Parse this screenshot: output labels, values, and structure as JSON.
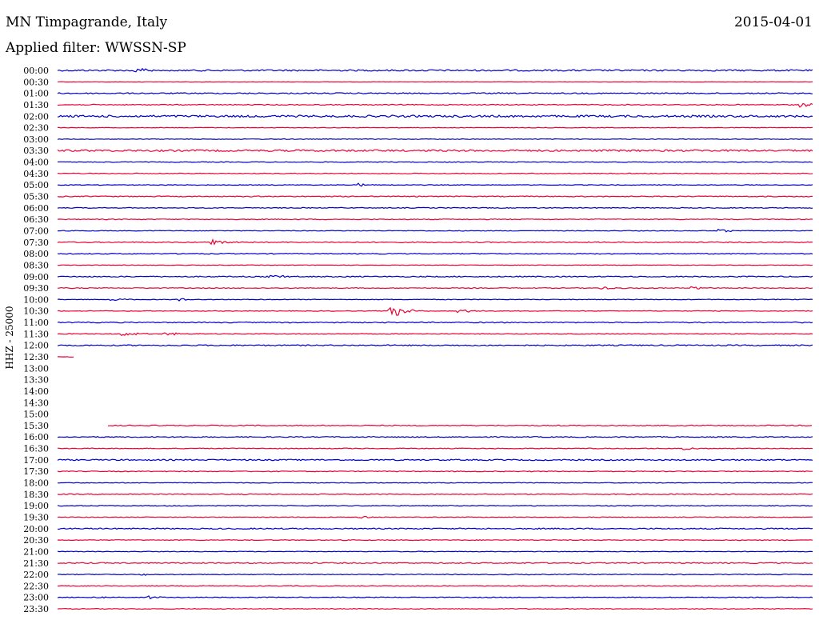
{
  "header": {
    "station": "MN Timpagrande, Italy",
    "date": "2015-04-01",
    "filter": "Applied filter: WWSSN-SP"
  },
  "channel_label": "HHZ - 25000",
  "colors": {
    "even_row": "#0000cc",
    "odd_row": "#ee0033"
  },
  "chart_data": {
    "type": "line",
    "title": "MN Timpagrande, Italy",
    "subtitle": "Applied filter: WWSSN-SP",
    "ylabel": "HHZ - 25000",
    "xlabel": "",
    "rows": [
      {
        "time": "00:00",
        "activity": 1.2,
        "events": [
          {
            "x": 0.1,
            "amp": 6
          }
        ]
      },
      {
        "time": "00:30",
        "activity": 0.3,
        "events": []
      },
      {
        "time": "01:00",
        "activity": 0.9,
        "events": []
      },
      {
        "time": "01:30",
        "activity": 0.7,
        "events": [
          {
            "x": 0.985,
            "amp": 3
          }
        ]
      },
      {
        "time": "02:00",
        "activity": 1.6,
        "events": []
      },
      {
        "time": "02:30",
        "activity": 0.4,
        "events": []
      },
      {
        "time": "03:00",
        "activity": 0.5,
        "events": []
      },
      {
        "time": "03:30",
        "activity": 1.4,
        "events": []
      },
      {
        "time": "04:00",
        "activity": 0.6,
        "events": []
      },
      {
        "time": "04:30",
        "activity": 0.6,
        "events": []
      },
      {
        "time": "05:00",
        "activity": 0.5,
        "events": [
          {
            "x": 0.4,
            "amp": 2
          }
        ]
      },
      {
        "time": "05:30",
        "activity": 0.7,
        "events": []
      },
      {
        "time": "06:00",
        "activity": 0.6,
        "events": []
      },
      {
        "time": "06:30",
        "activity": 0.6,
        "events": []
      },
      {
        "time": "07:00",
        "activity": 0.5,
        "events": [
          {
            "x": 0.875,
            "amp": 2
          }
        ]
      },
      {
        "time": "07:30",
        "activity": 0.8,
        "events": [
          {
            "x": 0.205,
            "amp": 5
          }
        ]
      },
      {
        "time": "08:00",
        "activity": 0.7,
        "events": []
      },
      {
        "time": "08:30",
        "activity": 0.4,
        "events": []
      },
      {
        "time": "09:00",
        "activity": 0.8,
        "events": [
          {
            "x": 0.28,
            "amp": 3
          }
        ]
      },
      {
        "time": "09:30",
        "activity": 0.6,
        "events": [
          {
            "x": 0.72,
            "amp": 2
          },
          {
            "x": 0.84,
            "amp": 2
          }
        ]
      },
      {
        "time": "10:00",
        "activity": 0.5,
        "events": [
          {
            "x": 0.07,
            "amp": 2
          },
          {
            "x": 0.16,
            "amp": 2
          }
        ]
      },
      {
        "time": "10:30",
        "activity": 0.5,
        "events": [
          {
            "x": 0.44,
            "amp": 10
          },
          {
            "x": 0.53,
            "amp": 3
          }
        ]
      },
      {
        "time": "11:00",
        "activity": 0.8,
        "events": []
      },
      {
        "time": "11:30",
        "activity": 0.6,
        "events": [
          {
            "x": 0.085,
            "amp": 3
          },
          {
            "x": 0.14,
            "amp": 3
          }
        ]
      },
      {
        "time": "12:00",
        "activity": 0.9,
        "events": []
      },
      {
        "time": "12:30",
        "activity": 0.6,
        "events": []
      },
      {
        "time": "13:00",
        "activity": 0,
        "events": []
      },
      {
        "time": "13:30",
        "activity": 0,
        "events": []
      },
      {
        "time": "14:00",
        "activity": 0,
        "events": []
      },
      {
        "time": "14:30",
        "activity": 0,
        "events": []
      },
      {
        "time": "15:00",
        "activity": 0,
        "events": []
      },
      {
        "time": "15:30",
        "activity": 0.7,
        "events": []
      },
      {
        "time": "16:00",
        "activity": 0.7,
        "events": []
      },
      {
        "time": "16:30",
        "activity": 0.6,
        "events": [
          {
            "x": 0.83,
            "amp": 2
          }
        ]
      },
      {
        "time": "17:00",
        "activity": 1.0,
        "events": []
      },
      {
        "time": "17:30",
        "activity": 0.6,
        "events": []
      },
      {
        "time": "18:00",
        "activity": 0.5,
        "events": []
      },
      {
        "time": "18:30",
        "activity": 0.7,
        "events": []
      },
      {
        "time": "19:00",
        "activity": 0.6,
        "events": []
      },
      {
        "time": "19:30",
        "activity": 0.5,
        "events": [
          {
            "x": 0.4,
            "amp": 2
          }
        ]
      },
      {
        "time": "20:00",
        "activity": 0.9,
        "events": []
      },
      {
        "time": "20:30",
        "activity": 0.6,
        "events": []
      },
      {
        "time": "21:00",
        "activity": 0.5,
        "events": []
      },
      {
        "time": "21:30",
        "activity": 0.8,
        "events": []
      },
      {
        "time": "22:00",
        "activity": 0.6,
        "events": [
          {
            "x": 0.11,
            "amp": 2
          }
        ]
      },
      {
        "time": "22:30",
        "activity": 0.6,
        "events": []
      },
      {
        "time": "23:00",
        "activity": 0.6,
        "events": [
          {
            "x": 0.05,
            "amp": 2
          },
          {
            "x": 0.12,
            "amp": 2
          }
        ]
      },
      {
        "time": "23:30",
        "activity": 0.6,
        "events": []
      }
    ]
  }
}
